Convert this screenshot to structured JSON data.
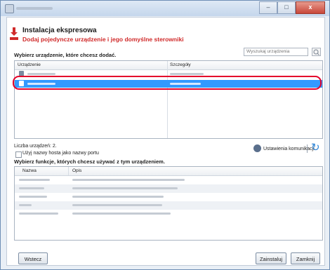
{
  "window": {
    "controls": {
      "minimize": "–",
      "maximize": "□",
      "close": "x"
    }
  },
  "header": {
    "title": "Instalacja ekspresowa",
    "subtitle": "Dodaj pojedyncze urządzenie i jego domyślne sterowniki"
  },
  "device_section": {
    "label": "Wybierz urządzenie, które chcesz dodać.",
    "search_placeholder": "Wyszukaj urządzenia",
    "columns": [
      "Urządzenie",
      "Szczegóły"
    ],
    "selected_row_index": 1,
    "count_text": "Liczba urządzeń: 2.",
    "hostname_checkbox": "Użyj nazwy hosta jako nazwy portu",
    "comm_settings": "Ustawienia komunikacji"
  },
  "functions_section": {
    "label": "Wybierz funkcje, których chcesz używać z tym urządzeniem.",
    "columns": [
      "Nazwa",
      "Opis"
    ]
  },
  "buttons": {
    "back": "Wstecz",
    "install": "Zainstaluj",
    "close": "Zamknij"
  },
  "colors": {
    "accent_red": "#d02a2a",
    "selection": "#3399ff",
    "highlight": "#e4002b"
  },
  "icons": {
    "header": "download-arrow-icon",
    "device": "printer-icon",
    "search": "search-icon",
    "settings": "gear-icon",
    "refresh": "refresh-icon"
  }
}
